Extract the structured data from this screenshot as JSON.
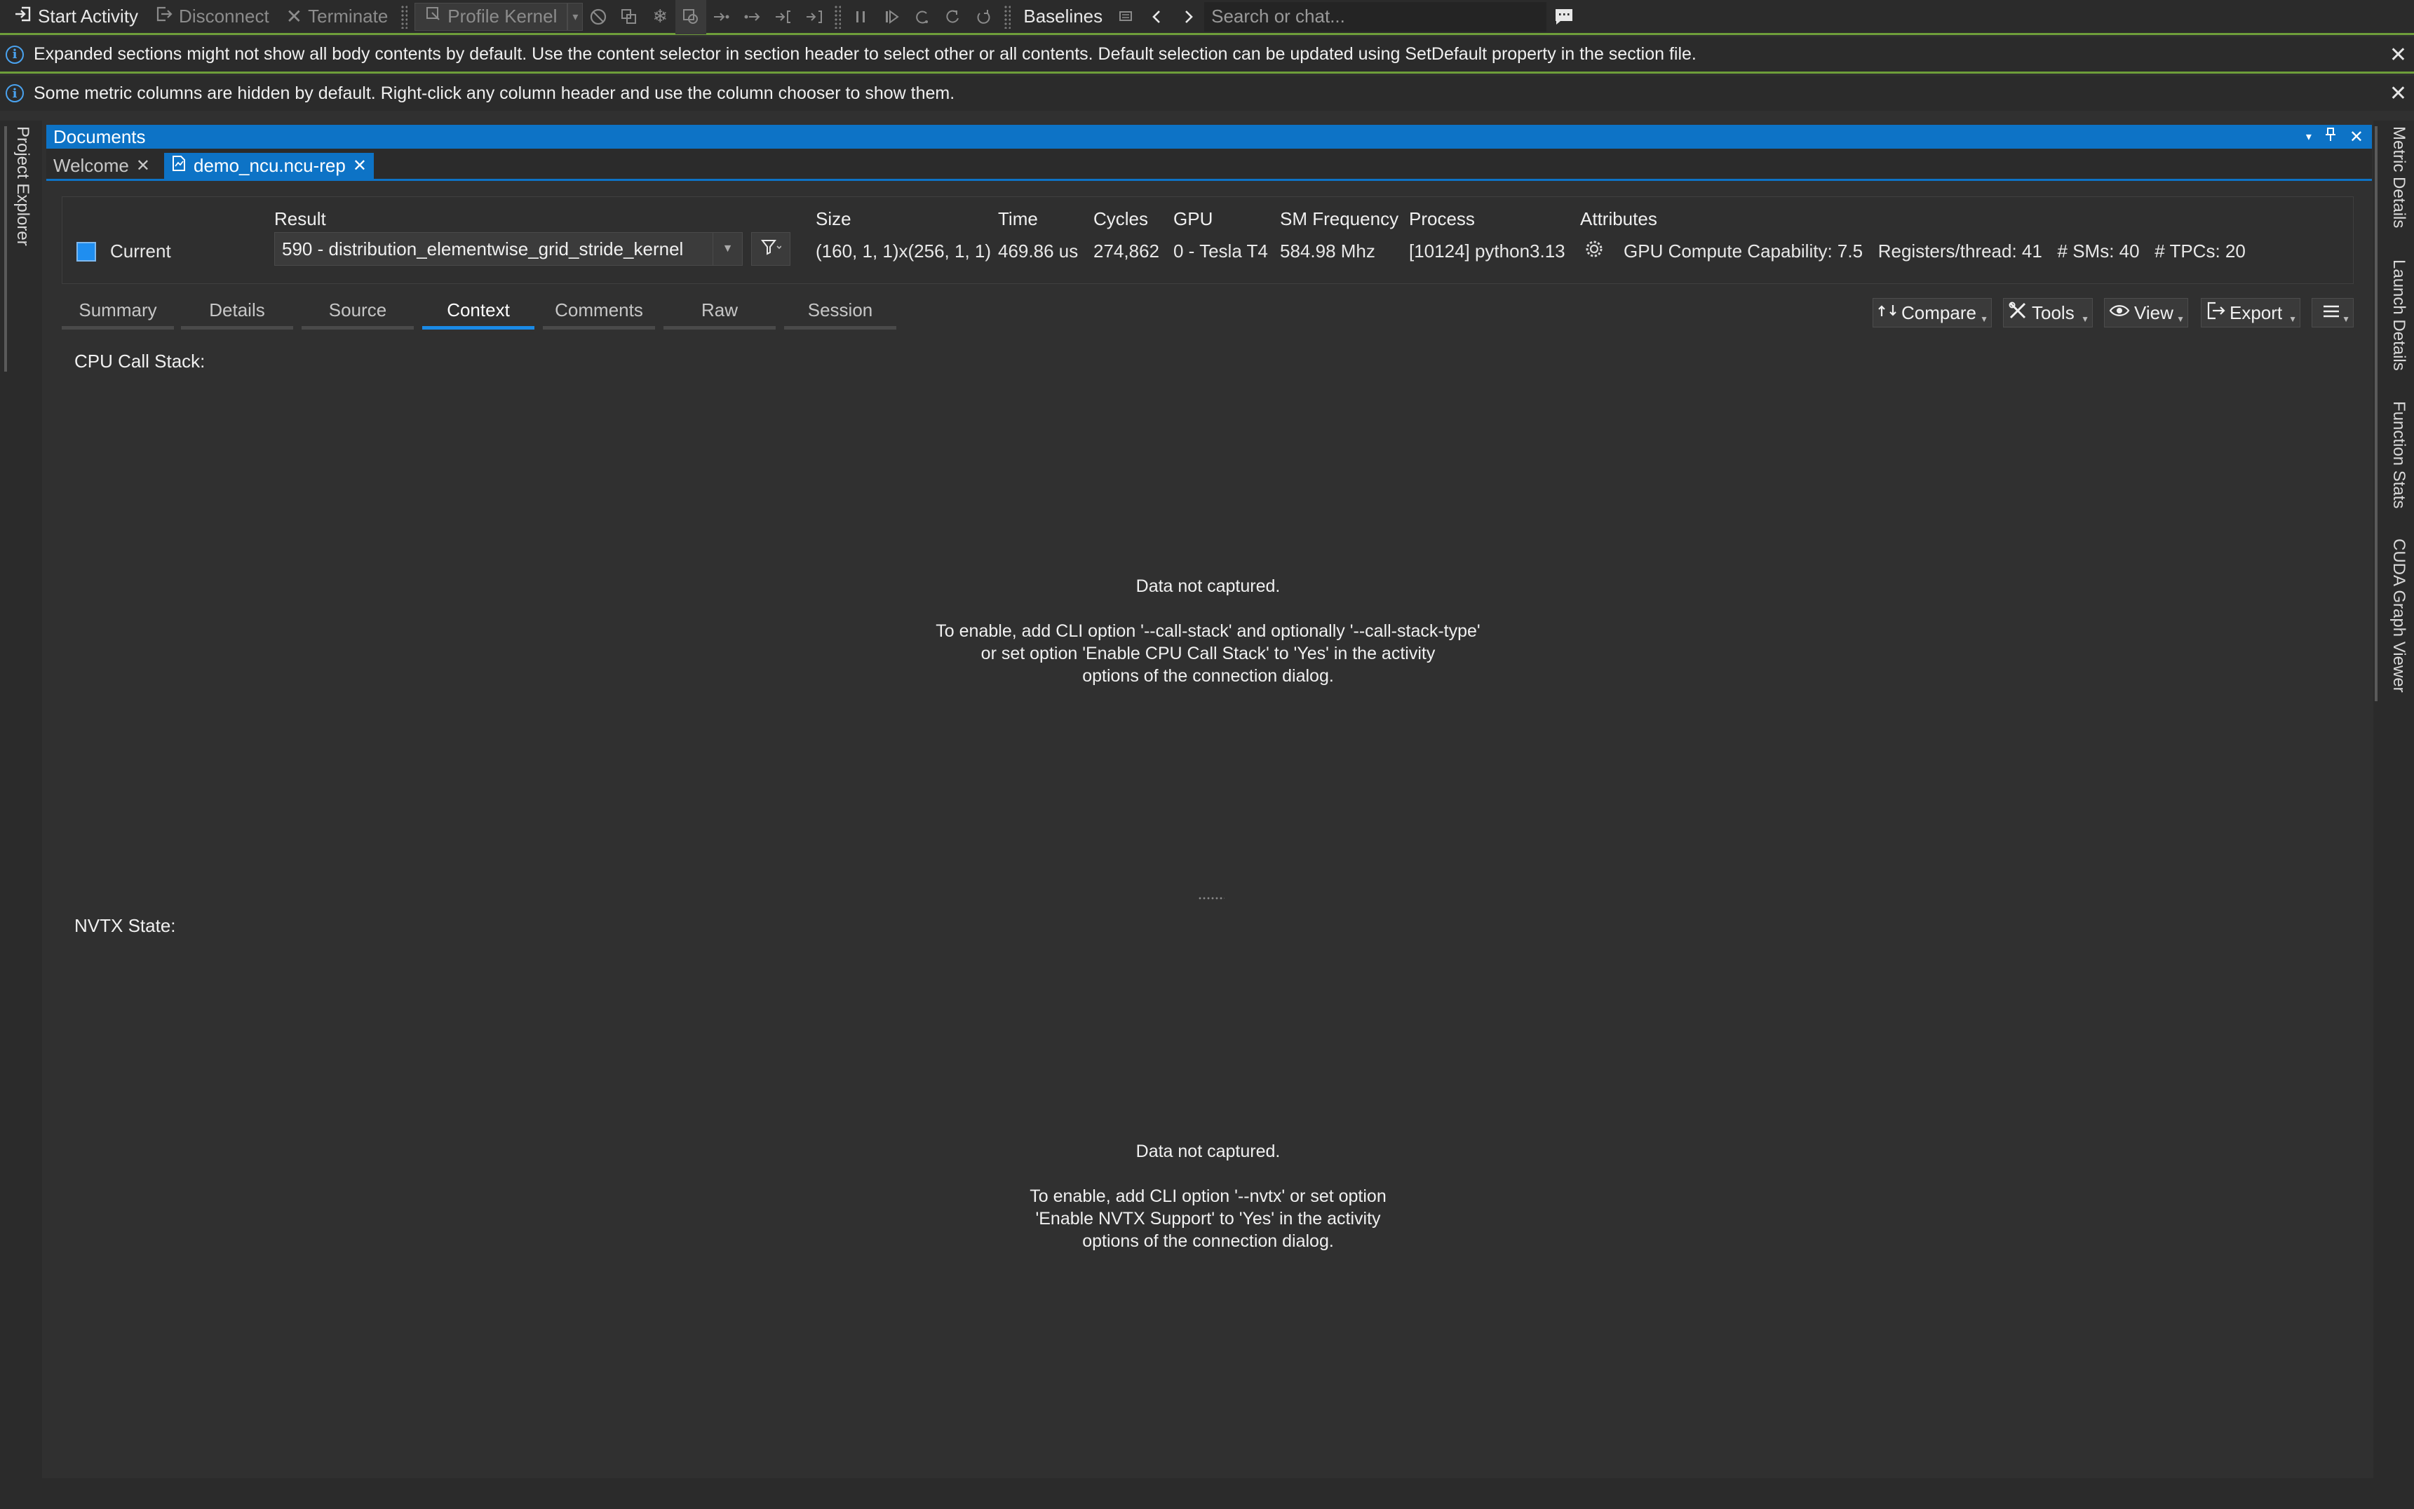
{
  "toolbar": {
    "start_activity": "Start Activity",
    "disconnect": "Disconnect",
    "terminate": "Terminate",
    "profile_kernel": "Profile Kernel",
    "baselines": "Baselines",
    "search_placeholder": "Search or chat..."
  },
  "infobars": [
    {
      "text": "Expanded sections might not show all body contents by default. Use the content selector in section header to select other or all contents. Default selection can be updated using SetDefault property in the section file."
    },
    {
      "text": "Some metric columns are hidden by default. Right-click any column header and use the column chooser to show them."
    }
  ],
  "left_dock": {
    "tabs": [
      "Project Explorer"
    ]
  },
  "right_dock": {
    "tabs": [
      "Metric Details",
      "Launch Details",
      "Function Stats",
      "CUDA Graph Viewer"
    ]
  },
  "documents": {
    "title": "Documents",
    "tabs": [
      {
        "label": "Welcome",
        "active": false
      },
      {
        "label": "demo_ncu.ncu-rep",
        "active": true
      }
    ]
  },
  "result_header": {
    "current_label": "Current",
    "current_color": "#1f8ef0",
    "columns": {
      "result": "Result",
      "size": "Size",
      "time": "Time",
      "cycles": "Cycles",
      "gpu": "GPU",
      "sm_frequency": "SM Frequency",
      "process": "Process",
      "attributes": "Attributes"
    },
    "values": {
      "result": "590 - distribution_elementwise_grid_stride_kernel",
      "size": "(160, 1, 1)x(256, 1, 1)",
      "time": "469.86 us",
      "cycles": "274,862",
      "gpu": "0 - Tesla T4",
      "sm_frequency": "584.98 Mhz",
      "process": "[10124] python3.13",
      "attributes": "GPU Compute Capability: 7.5   Registers/thread: 41   # SMs: 40   # TPCs: 20"
    }
  },
  "section_tabs": [
    {
      "label": "Summary",
      "active": false
    },
    {
      "label": "Details",
      "active": false
    },
    {
      "label": "Source",
      "active": false
    },
    {
      "label": "Context",
      "active": true
    },
    {
      "label": "Comments",
      "active": false
    },
    {
      "label": "Raw",
      "active": false
    },
    {
      "label": "Session",
      "active": false
    }
  ],
  "actions": {
    "compare": "Compare",
    "tools": "Tools",
    "view": "View",
    "export": "Export"
  },
  "context": {
    "cpu_call_stack": {
      "label": "CPU Call Stack:",
      "status": "Data not captured.",
      "hint_lines": [
        "To enable, add CLI option '--call-stack' and optionally '--call-stack-type'",
        "or set option 'Enable CPU Call Stack' to 'Yes' in the activity",
        "options of the connection dialog."
      ]
    },
    "nvtx_state": {
      "label": "NVTX State:",
      "status": "Data not captured.",
      "hint_lines": [
        "To enable, add CLI option '--nvtx' or set option",
        "'Enable NVTX Support' to 'Yes' in the activity",
        "options of the connection dialog."
      ]
    }
  },
  "colors": {
    "accent": "#0d73c6",
    "toolbar_rule": "#6e9e3a",
    "info": "#4aa3f0"
  }
}
